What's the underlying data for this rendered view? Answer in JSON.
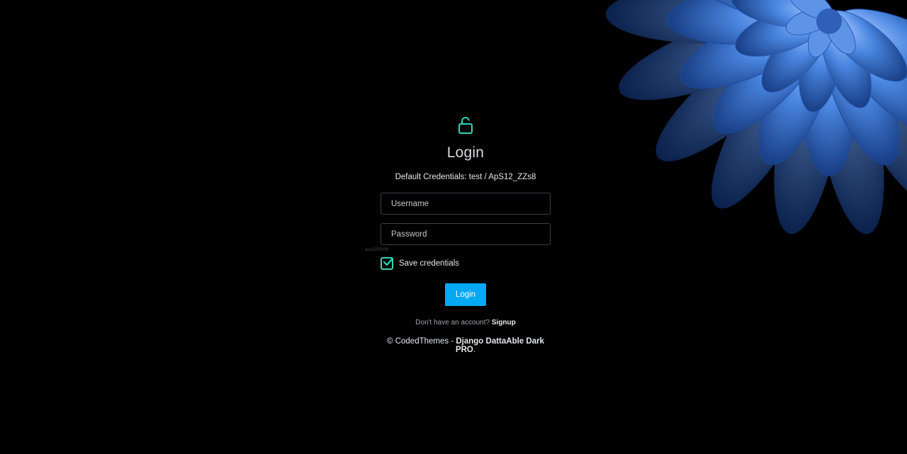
{
  "colors": {
    "background": "#000000",
    "accent_teal": "#2ed8b6",
    "button_blue": "#04a9f5",
    "flower_blue": "#3d7fd9"
  },
  "icons": {
    "lock": "unlocked-padlock-icon",
    "checkbox": "check-icon"
  },
  "login": {
    "title": "Login",
    "credentials_hint": "Default Credentials: test / ApS12_ZZs8",
    "username_placeholder": "Username",
    "password_placeholder": "Password",
    "remember_label": "Save credentials",
    "remember_checked": true,
    "submit_label": "Login",
    "no_account_text": "Don't have an account?",
    "signup_link": "Signup",
    "tiny_text": "asu2009999"
  },
  "footer": {
    "copyright": "© CodedThemes - ",
    "product": "Django DattaAble Dark PRO",
    "suffix": "."
  }
}
